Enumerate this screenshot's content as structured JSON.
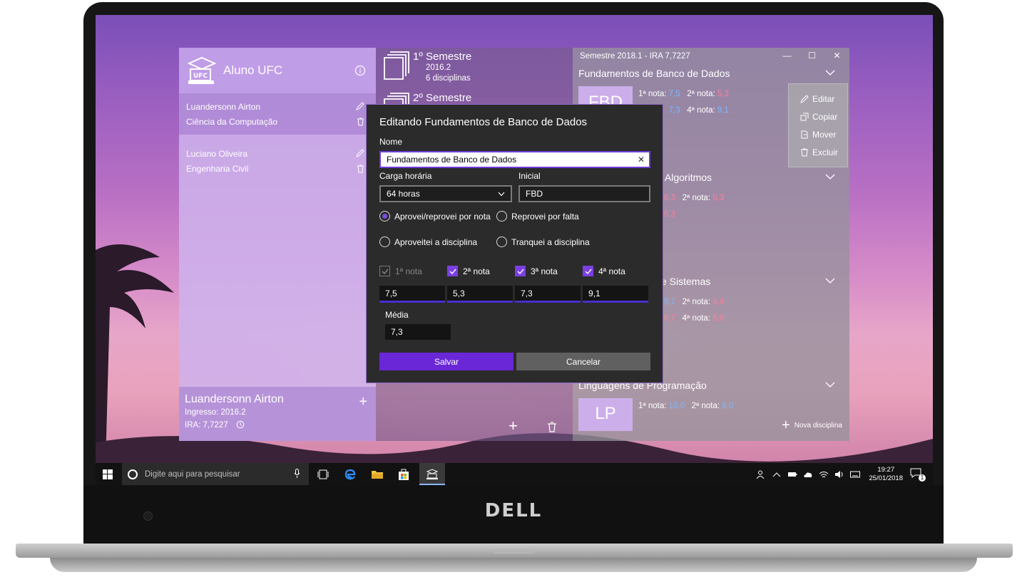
{
  "brand": {
    "laptop_logo": "DELL"
  },
  "app": {
    "title": "Aluno UFC",
    "students": [
      {
        "name": "Luandersonn Airton",
        "course": "Ciência da Computação"
      },
      {
        "name": "Luciano Oliveira",
        "course": "Engenharia Civil"
      }
    ],
    "footer": {
      "name": "Luandersonn Airton",
      "ingresso": "Ingresso: 2016.2",
      "ira": "IRA: 7,7227"
    },
    "semesters": [
      {
        "title": "1º Semestre",
        "year": "2016.2",
        "count": "6 disciplinas"
      },
      {
        "title": "2º Semestre"
      }
    ],
    "window_title": "Semestre 2018.1 - IRA 7,7227",
    "courses": [
      {
        "name": "Fundamentos de Banco de Dados",
        "initials": "FBD",
        "g1_label": "1ª nota:",
        "g1": "7,5",
        "g2_label": "2ª nota:",
        "g2": "5,3",
        "g4_label": "4ª nota:",
        "g3": "7,3",
        "g4": "9,1"
      },
      {
        "name": "e Algoritmos",
        "g1": "6,3",
        "g2_label": "2ª nota:",
        "g2": "5,3",
        "g3": "6,3"
      },
      {
        "name": "e Sistemas",
        "g1": "9,1",
        "g2_label": "2ª nota:",
        "g2": "4,4",
        "g3": "6,7",
        "g4_label": "4ª nota:",
        "g4": "5,0"
      },
      {
        "name": "Linguagens de Programação",
        "initials": "LP",
        "g1_label": "1ª nota:",
        "g1": "10,0",
        "g2_label": "2ª nota:",
        "g2": "8,0"
      }
    ],
    "context_menu": [
      "Editar",
      "Copiar",
      "Mover",
      "Excluir"
    ],
    "new_course": "Nova disciplina"
  },
  "dialog": {
    "title": "Editando Fundamentos de Banco de Dados",
    "name_label": "Nome",
    "name_value": "Fundamentos de Banco de Dados",
    "hours_label": "Carga horária",
    "hours_value": "64 horas",
    "initial_label": "Inicial",
    "initial_value": "FBD",
    "radios": [
      "Aprovei/reprovei por nota",
      "Reprovei por falta",
      "Aproveitei a disciplina",
      "Tranquei a disciplina"
    ],
    "selected_radio": "Aprovei/reprovei por nota",
    "checks": [
      {
        "label": "1ª nota",
        "checked": true,
        "disabled": true
      },
      {
        "label": "2ª nota",
        "checked": true
      },
      {
        "label": "3ª nota",
        "checked": true
      },
      {
        "label": "4ª nota",
        "checked": true
      }
    ],
    "grades": [
      "7,5",
      "5,3",
      "7,3",
      "9,1"
    ],
    "average_label": "Média",
    "average_value": "7,3",
    "save": "Salvar",
    "cancel": "Cancelar"
  },
  "taskbar": {
    "search_placeholder": "Digite aqui para pesquisar",
    "time": "19:27",
    "date": "25/01/2018",
    "notifications": "1"
  },
  "colors": {
    "accent": "#6a27d7",
    "grade_blue": "#7ab8ff",
    "grade_red": "#ff7f9a"
  }
}
